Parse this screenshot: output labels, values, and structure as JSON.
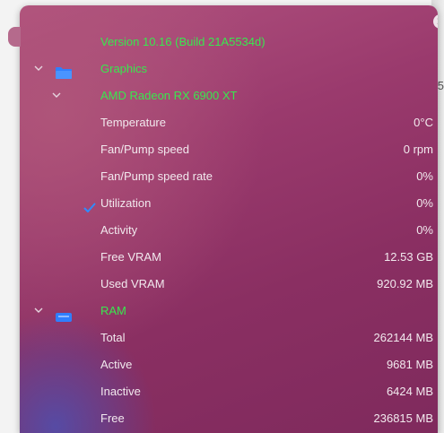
{
  "popover": {
    "version": "Version 10.16 (Build 21A5534d)",
    "close_icon": "close-icon"
  },
  "graphics": {
    "section_label": "Graphics",
    "gpu_name": "AMD Radeon RX 6900 XT",
    "rows": [
      {
        "label": "Temperature",
        "value": "0°C"
      },
      {
        "label": "Fan/Pump speed",
        "value": "0 rpm"
      },
      {
        "label": "Fan/Pump speed rate",
        "value": "0%"
      },
      {
        "label": "Utilization",
        "value": "0%"
      },
      {
        "label": "Activity",
        "value": "0%"
      },
      {
        "label": "Free VRAM",
        "value": "12.53 GB"
      },
      {
        "label": "Used VRAM",
        "value": "920.92 MB"
      }
    ]
  },
  "ram": {
    "section_label": "RAM",
    "rows": [
      {
        "label": "Total",
        "value": "262144 MB"
      },
      {
        "label": "Active",
        "value": "9681 MB"
      },
      {
        "label": "Inactive",
        "value": "6424 MB"
      },
      {
        "label": "Free",
        "value": "236815 MB"
      }
    ]
  },
  "background": {
    "fragment": "5"
  },
  "colors": {
    "accent_green": "#38e84e",
    "panel_bg": "#8a2f62",
    "checkmark_blue": "#2f8cff",
    "icon_blue": "#2f7fff"
  }
}
